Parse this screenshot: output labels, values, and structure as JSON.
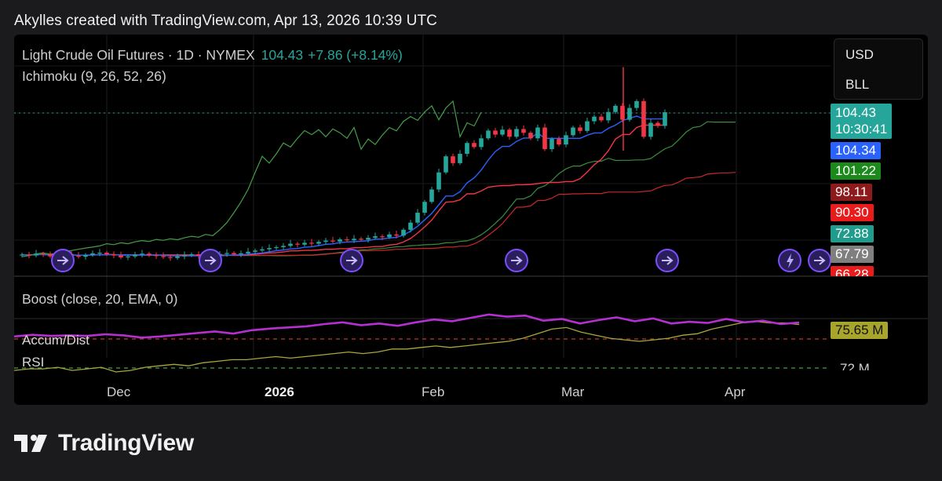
{
  "header": {
    "text": "Akylles created with TradingView.com, Apr 13, 2026 10:39 UTC"
  },
  "symbol": {
    "title": "Light Crude Oil Futures · 1D · NYMEX",
    "price": "104.43",
    "change": "+7.86 (+8.14%)"
  },
  "indicators": {
    "ichimoku": "Ichimoku (9, 26, 52, 26)",
    "boost": "Boost (close, 20, EMA, 0)",
    "accum": "Accum/Dist",
    "rsi": "RSI"
  },
  "currency_menu": {
    "currency": "USD",
    "unit": "BLL"
  },
  "price_labels": {
    "last_price": "104.43",
    "countdown": "10:30:41",
    "conversion": "104.34",
    "span_a": "101.22",
    "base": "98.11",
    "span_red": "90.30",
    "lagging": "72.88",
    "cloud_low": "67.79",
    "lower": "66.28",
    "accum_value": "75.65 M",
    "accum_tick": "72 M"
  },
  "x_axis": {
    "dec": "Dec",
    "year": "2026",
    "feb": "Feb",
    "mar": "Mar",
    "apr": "Apr"
  },
  "colors": {
    "up": "#26a69a",
    "down": "#f23645",
    "conversion": "#2962ff",
    "base_line": "#f23645",
    "lagging": "#43a047",
    "accum": "#b52fd1",
    "rsi": "#a8a83a",
    "event": "#7c4dff"
  },
  "event_icons": [
    "dividend-icon",
    "dividend-icon",
    "dividend-icon",
    "dividend-icon",
    "dividend-icon",
    "lightning-icon",
    "dividend-icon"
  ],
  "footer": {
    "brand": "TradingView"
  },
  "chart_data": {
    "type": "line",
    "title": "Light Crude Oil Futures · 1D · NYMEX",
    "x_ticks": [
      "Dec",
      "2026",
      "Feb",
      "Mar",
      "Apr"
    ],
    "price_scale_labels": [
      104.43,
      104.34,
      101.22,
      98.11,
      90.3,
      72.88,
      67.79,
      66.28
    ],
    "series": [
      {
        "name": "Ichimoku (9, 26, 52, 26)",
        "role": "price",
        "close_approx": [
          58.5,
          58.2,
          58.8,
          58.6,
          57.9,
          58.3,
          58.7,
          58.1,
          57.8,
          58.4,
          58.9,
          59.1,
          58.6,
          58.2,
          57.6,
          57.9,
          58.5,
          58.8,
          58.3,
          58.0,
          57.7,
          57.4,
          57.9,
          58.3,
          58.6,
          58.1,
          57.8,
          58.2,
          58.7,
          59.0,
          58.6,
          58.9,
          59.4,
          59.8,
          60.2,
          60.6,
          60.9,
          61.3,
          62.0,
          61.7,
          62.3,
          62.0,
          62.6,
          63.0,
          62.7,
          63.4,
          63.1,
          63.6,
          63.3,
          63.9,
          64.4,
          64.1,
          65.0,
          64.6,
          66.5,
          68.8,
          72.0,
          75.5,
          79.5,
          85.0,
          90.2,
          88.0,
          91.0,
          94.5,
          93.2,
          96.0,
          98.5,
          97.2,
          98.8,
          96.5,
          99.0,
          97.8,
          96.0,
          99.5,
          92.5,
          95.8,
          94.0,
          97.0,
          99.5,
          98.4,
          101.5,
          103.0,
          101.8,
          104.5,
          106.5,
          102.0,
          105.8,
          108.0,
          96.5,
          101.0,
          100.0,
          104.43
        ]
      },
      {
        "name": "Accum/Dist",
        "values_m": [
          72.3,
          72.6,
          72.4,
          72.5,
          72.4,
          72.7,
          72.5,
          72.1,
          72.3,
          72.6,
          72.9,
          73.2,
          72.8,
          73.4,
          73.7,
          73.9,
          74.1,
          74.5,
          74.8,
          74.3,
          74.6,
          74.2,
          74.8,
          75.3,
          75.0,
          75.6,
          76.2,
          75.8,
          76.0,
          75.1,
          75.4,
          74.6,
          75.2,
          75.7,
          75.0,
          75.5,
          74.6,
          74.9,
          74.7,
          75.4,
          74.8,
          75.1,
          74.5,
          74.76
        ]
      },
      {
        "name": "RSI",
        "values": [
          39,
          40,
          40,
          41,
          39,
          40,
          41,
          38,
          39,
          41,
          42,
          43,
          42,
          44,
          45,
          46,
          46,
          47,
          48,
          47,
          48,
          49,
          50,
          51,
          50,
          51,
          53,
          53,
          54,
          55,
          54,
          55,
          56,
          57,
          58,
          60,
          63,
          66,
          67,
          64,
          62,
          60,
          59,
          58,
          59,
          60,
          62,
          63,
          66,
          68,
          70,
          71,
          70,
          70,
          69
        ]
      }
    ]
  }
}
